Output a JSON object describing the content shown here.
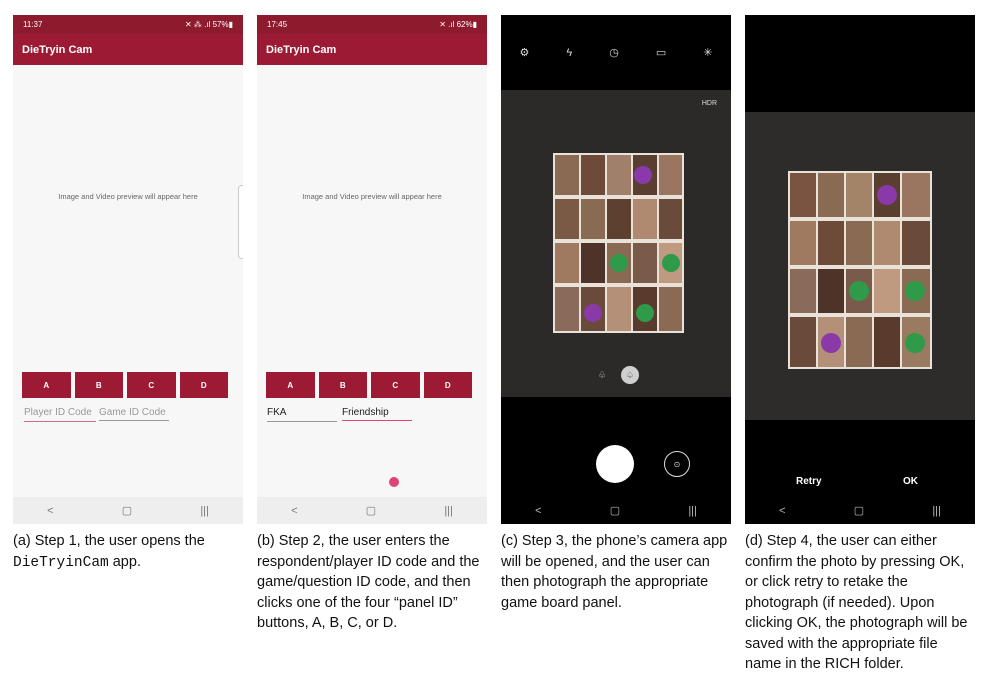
{
  "panels": [
    {
      "status": {
        "time": "11:37",
        "icons": "✕ ⁂ .ıl 57%▮"
      },
      "app_title": "DieTryin Cam",
      "preview_text": "Image and Video preview will appear here",
      "buttons": [
        "A",
        "B",
        "C",
        "D"
      ],
      "player_field": {
        "value": "",
        "placeholder": "Player ID Code"
      },
      "game_field": {
        "value": "",
        "placeholder": "Game ID Code"
      },
      "caption": {
        "prefix": "(a) Step 1, the user opens the ",
        "app_name": "DieTryinCam",
        "suffix": " app."
      }
    },
    {
      "status": {
        "time": "17:45",
        "icons": "✕ .ıl 62%▮"
      },
      "app_title": "DieTryin Cam",
      "preview_text": "Image and Video preview will appear here",
      "buttons": [
        "A",
        "B",
        "C",
        "D"
      ],
      "player_field": {
        "value": "FKA"
      },
      "game_field": {
        "value": "Friendship"
      },
      "caption": {
        "text": "(b) Step 2, the user enters the respondent/player ID code and the game/question ID code, and then clicks one of the four “panel ID” buttons, A, B, C, or D."
      }
    },
    {
      "camera_toolbar": [
        "settings-icon",
        "flash-off-icon",
        "timer-off-icon",
        "ratio-3-4-icon",
        "motion-icon"
      ],
      "hdr_label": "HDR",
      "caption": {
        "text": "(c) Step 3, the phone’s camera app will be opened, and the user can then photograph the appropriate game board panel."
      }
    },
    {
      "retry_label": "Retry",
      "ok_label": "OK",
      "caption": {
        "text": "(d) Step 4, the user can either confirm the photo by pressing OK, or click retry to retake the photograph (if needed). Upon clicking OK, the photograph will be saved with the appropriate file name in the RICH folder."
      }
    }
  ],
  "navbar": {
    "back": "<",
    "home": "▢",
    "recents": "|||"
  },
  "colors": {
    "brand": "#9c1a33",
    "status_bar": "#8e1a2e",
    "accent_underline": "#e0437a"
  }
}
